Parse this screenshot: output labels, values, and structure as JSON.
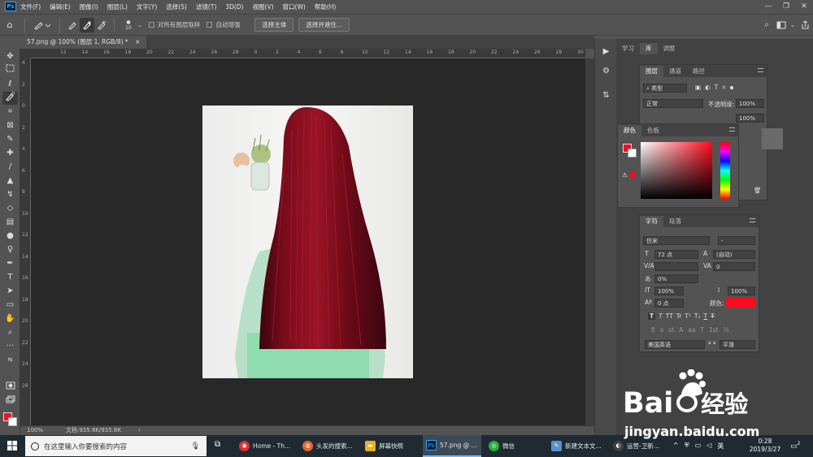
{
  "app": {
    "logo": "Ps"
  },
  "menu": [
    "文件(F)",
    "编辑(E)",
    "图像(I)",
    "图层(L)",
    "文字(Y)",
    "选择(S)",
    "滤镜(T)",
    "3D(D)",
    "视图(V)",
    "窗口(W)",
    "帮助(H)"
  ],
  "window_controls": [
    "—",
    "❐",
    "✕"
  ],
  "options": {
    "brush_size": "10",
    "sample_all_layers": "对所有图层取样",
    "auto_enhance": "自动增强",
    "select_subject": "选择主体",
    "select_and_mask": "选择并遮住..."
  },
  "document_tab": {
    "title": "57.png @ 100% (图层 1, RGB/8) *",
    "close": "×"
  },
  "ruler_h": [
    "12",
    "14",
    "16",
    "18",
    "20",
    "22",
    "24",
    "26",
    "28",
    "0",
    "2",
    "4",
    "6",
    "8",
    "10",
    "12",
    "14",
    "16",
    "18",
    "20",
    "22",
    "24",
    "26",
    "28",
    "30"
  ],
  "ruler_v": [
    "4",
    "2",
    "0",
    "2",
    "4",
    "6",
    "8",
    "10",
    "12",
    "14",
    "16",
    "18",
    "20",
    "22",
    "24",
    "26"
  ],
  "status": {
    "zoom": "100%",
    "doc": "文档:935.8K/935.8K"
  },
  "panels": {
    "top_tabs": [
      "学习",
      "库",
      "调整"
    ],
    "layers": {
      "tabs": [
        "图层",
        "通道",
        "路径"
      ],
      "filter": "类型",
      "blend": "正常",
      "opacity_label": "不透明度:",
      "opacity": "100%",
      "fill": "100%"
    },
    "color": {
      "tabs": [
        "颜色",
        "色板"
      ]
    },
    "character": {
      "tabs": [
        "字符",
        "段落"
      ],
      "font": "仿宋",
      "style": "-",
      "size": "72 点",
      "leading": "(自动)",
      "kerning": "",
      "tracking": "0",
      "scale_pct": "0%",
      "vscale": "100%",
      "hscale": "100%",
      "baseline": "0 点",
      "color_label": "颜色:",
      "language": "美国英语",
      "aa_label": "a a",
      "aa": "平滑",
      "type_buttons": [
        "T",
        "T",
        "TT",
        "Tr",
        "T¹",
        "T₁",
        "T",
        "T"
      ],
      "ot_buttons": [
        "fi",
        "ꝺ",
        "st",
        "A",
        "aa",
        "T",
        "1st",
        "½"
      ]
    },
    "colors": {
      "foreground": "#ff0a1e",
      "text_color": "#ff0a1e"
    }
  },
  "taskbar": {
    "search_placeholder": "在这里输入你要搜索的内容",
    "items": [
      {
        "label": "Home - Th...",
        "color": "#e03030"
      },
      {
        "label": "头发的搜索...",
        "color": "#e0682a"
      },
      {
        "label": "屏幕快照",
        "color": "#e8b020"
      },
      {
        "label": "57.png @ ...",
        "color": "#001e36"
      },
      {
        "label": "微信",
        "color": "#2aae3a"
      },
      {
        "label": "新建文本文...",
        "color": "#5a8fd0"
      },
      {
        "label": "运营-卫新...",
        "color": "#404040"
      }
    ],
    "tray": {
      "ime": "英",
      "time": "0:28",
      "date": "2019/3/27",
      "notif": "2"
    }
  },
  "watermark": {
    "brand": "Bai",
    "brand2": "经验",
    "url": "jingyan.baidu.com"
  }
}
